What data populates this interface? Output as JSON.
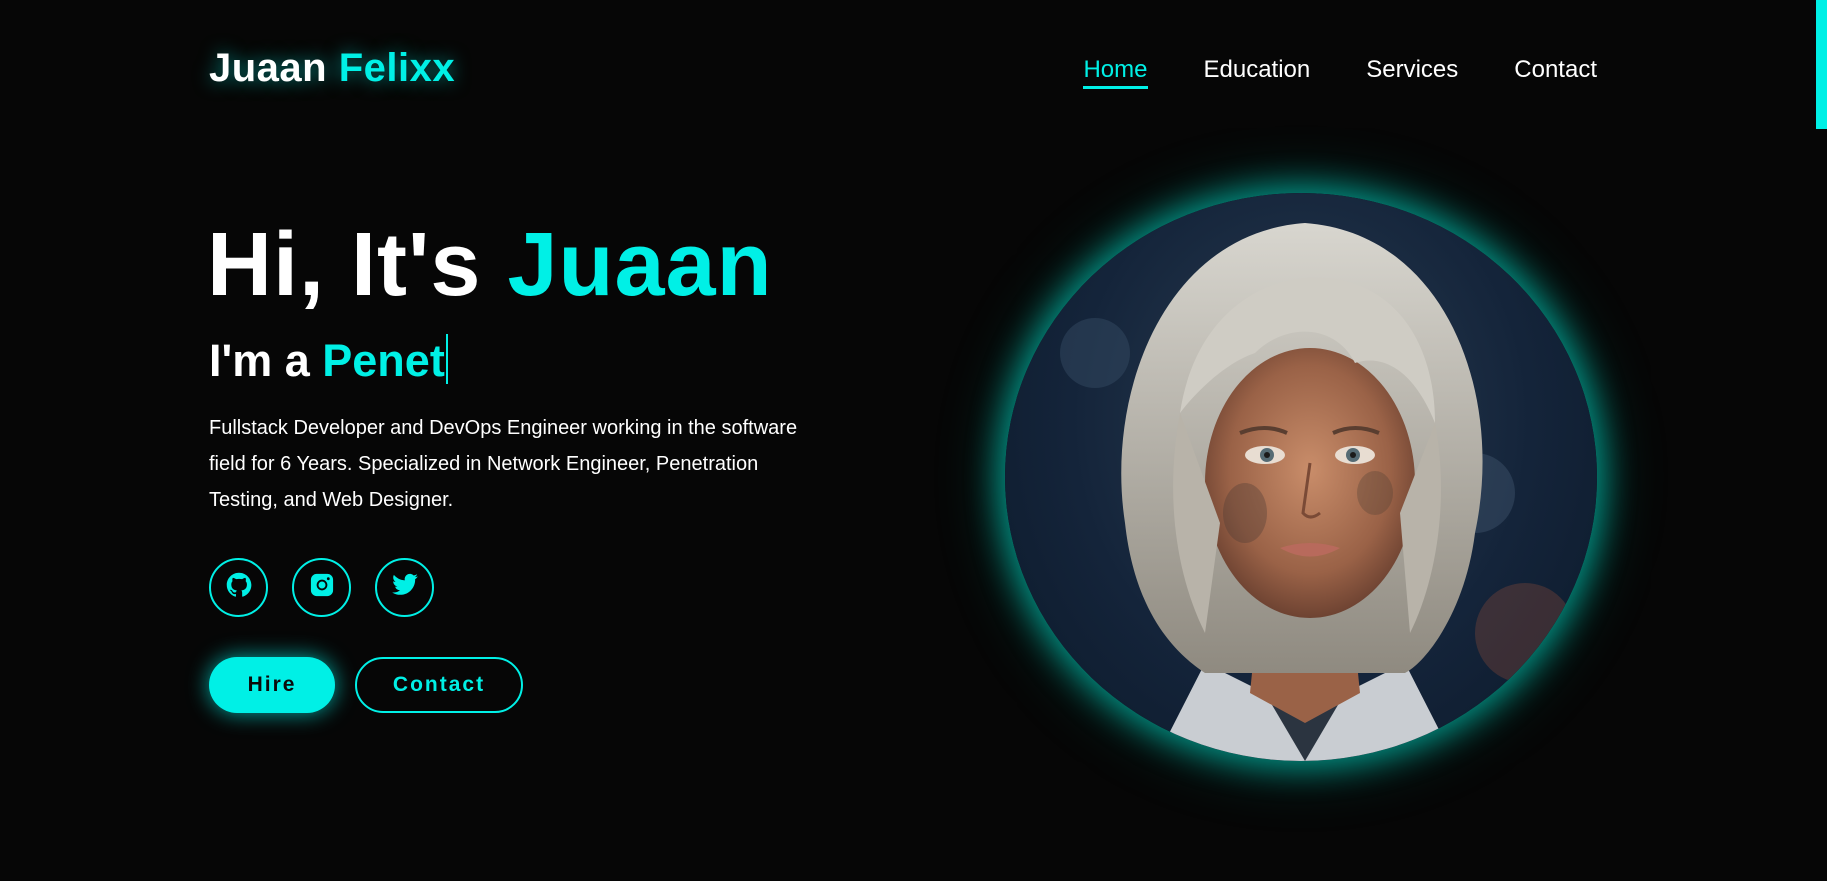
{
  "header": {
    "logo_first": "Juaan",
    "logo_second": "Felixx",
    "nav": [
      {
        "label": "Home",
        "active": true
      },
      {
        "label": "Education",
        "active": false
      },
      {
        "label": "Services",
        "active": false
      },
      {
        "label": "Contact",
        "active": false
      }
    ]
  },
  "hero": {
    "greeting": "Hi, It's",
    "name": "Juaan",
    "role_prefix": "I'm a",
    "role_typed": "Penet",
    "description": "Fullstack Developer and DevOps Engineer working in the software field for 6 Years. Specialized in Network Engineer, Penetration Testing, and Web Designer.",
    "socials": [
      {
        "icon": "github-icon"
      },
      {
        "icon": "instagram-icon"
      },
      {
        "icon": "twitter-icon"
      }
    ],
    "hire_label": "Hire",
    "contact_label": "Contact"
  },
  "colors": {
    "accent": "#00f0e6",
    "background": "#060606",
    "text": "#ffffff"
  }
}
